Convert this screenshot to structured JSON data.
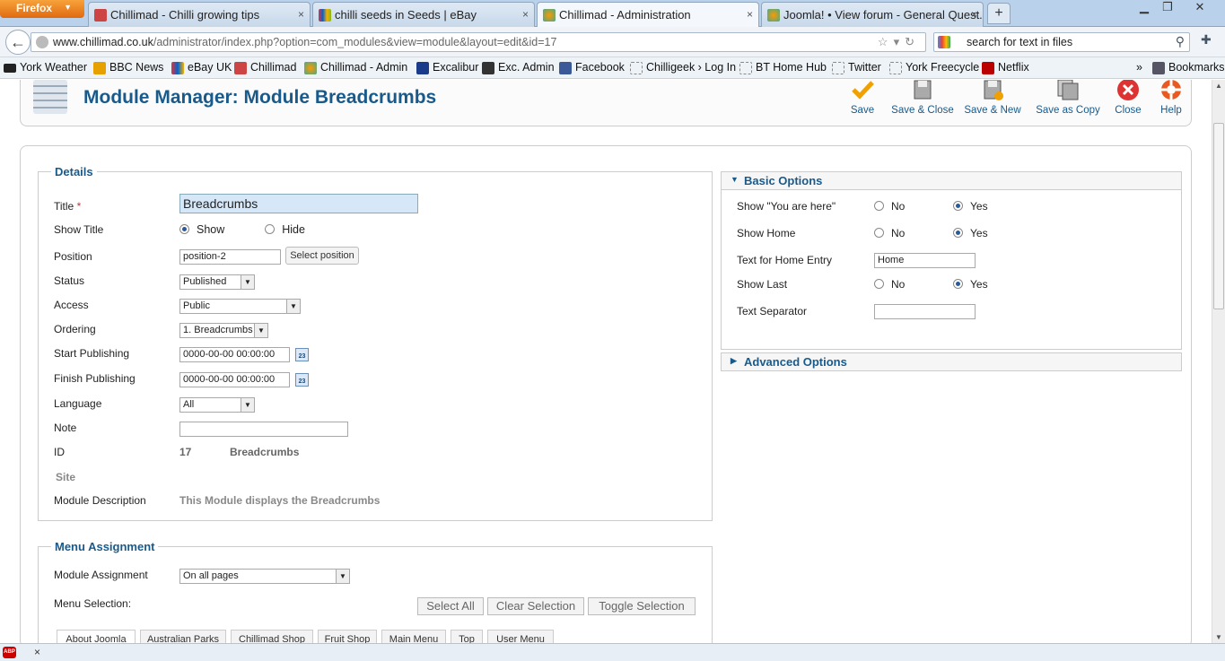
{
  "browser": {
    "menu_label": "Firefox",
    "tabs": [
      {
        "title": "Chillimad - Chilli growing tips",
        "close": "×"
      },
      {
        "title": "chilli seeds in Seeds | eBay",
        "close": "×"
      },
      {
        "title": "Chillimad - Administration",
        "close": "×"
      },
      {
        "title": "Joomla! • View forum - General Quest...",
        "close": "×"
      }
    ],
    "new_tab": "+",
    "url_host": "www.chillimad.co.uk",
    "url_path": "/administrator/index.php?option=com_modules&view=module&layout=edit&id=17",
    "search_text": "search for text in files",
    "bookmarks": [
      "York Weather",
      "BBC News",
      "eBay UK",
      "Chillimad",
      "Chillimad - Admin",
      "Excalibur",
      "Exc. Admin",
      "Facebook",
      "Chilligeek › Log In",
      "BT Home Hub",
      "Twitter",
      "York Freecycle",
      "Netflix"
    ],
    "bookmarks_overflow": "»",
    "bookmarks_menu": "Bookmarks"
  },
  "toolbar": {
    "title": "Module Manager: Module Breadcrumbs",
    "buttons": [
      "Save",
      "Save & Close",
      "Save & New",
      "Save as Copy",
      "Close",
      "Help"
    ]
  },
  "details": {
    "legend": "Details",
    "title_label": "Title",
    "required_mark": "*",
    "title_value": "Breadcrumbs",
    "show_title_label": "Show Title",
    "show_option": "Show",
    "hide_option": "Hide",
    "position_label": "Position",
    "position_value": "position-2",
    "select_position": "Select position",
    "status_label": "Status",
    "status_value": "Published",
    "access_label": "Access",
    "access_value": "Public",
    "ordering_label": "Ordering",
    "ordering_value": "1. Breadcrumbs",
    "start_label": "Start Publishing",
    "start_value": "0000-00-00 00:00:00",
    "finish_label": "Finish Publishing",
    "finish_value": "0000-00-00 00:00:00",
    "calendar_text": "23",
    "language_label": "Language",
    "language_value": "All",
    "note_label": "Note",
    "note_value": "",
    "id_label": "ID",
    "id_value": "17",
    "id_name": "Breadcrumbs",
    "site_label": "Site",
    "desc_label": "Module Description",
    "desc_value": "This Module displays the Breadcrumbs"
  },
  "menu_assignment": {
    "legend": "Menu Assignment",
    "assign_label": "Module Assignment",
    "assign_value": "On all pages",
    "selection_label": "Menu Selection:",
    "buttons": [
      "Select All",
      "Clear Selection",
      "Toggle Selection"
    ],
    "tabs": [
      "About Joomla",
      "Australian Parks",
      "Chillimad Shop",
      "Fruit Shop",
      "Main Menu",
      "Top",
      "User Menu"
    ]
  },
  "basic_options": {
    "header": "Basic Options",
    "show_here_label": "Show \"You are here\"",
    "show_home_label": "Show Home",
    "home_text_label": "Text for Home Entry",
    "home_text_value": "Home",
    "show_last_label": "Show Last",
    "separator_label": "Text Separator",
    "separator_value": "",
    "no": "No",
    "yes": "Yes"
  },
  "advanced_options": {
    "header": "Advanced Options"
  },
  "statusbar": {
    "abp": "ABP",
    "close": "×"
  }
}
